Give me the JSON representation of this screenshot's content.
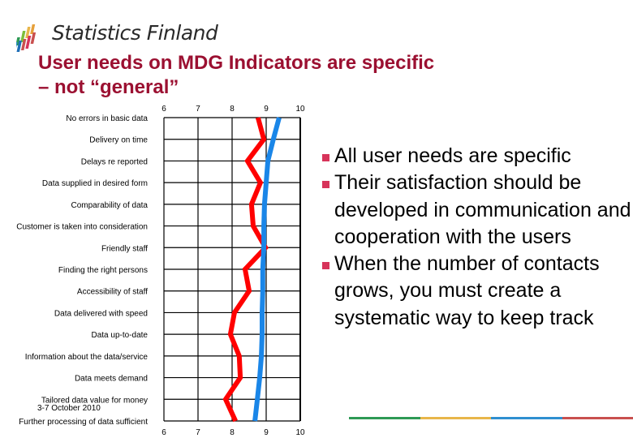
{
  "header": {
    "brand": "Statistics Finland",
    "title_line1": "User needs on MDG Indicators are specific",
    "title_line2": "– not “general”"
  },
  "footer": {
    "date": "3-7 October 2010"
  },
  "bullets": [
    "All user needs are specific",
    "Their satisfaction should be developed in communication and cooperation with the users",
    "When the number of contacts grows, you must create a systematic way to keep track"
  ],
  "colors": {
    "title": "#9b1031",
    "bullet": "#d7345a",
    "series_red": "#ff0000",
    "series_blue": "#1a86e8",
    "stripe": [
      "#2e9a55",
      "#e8b64a",
      "#2f8fd0",
      "#c9504f"
    ],
    "logo": [
      "#2e9a55",
      "#7cbf3a",
      "#e8b64a",
      "#e6a03a",
      "#2f8fd0",
      "#1f6fb8",
      "#c9504f",
      "#d7345a"
    ]
  },
  "chart_data": {
    "type": "line",
    "orientation": "horizontal-profile",
    "title": "",
    "xlabel": "",
    "ylabel": "",
    "xlim": [
      6,
      10
    ],
    "x_ticks": [
      "6",
      "7",
      "8",
      "9",
      "10"
    ],
    "grid": true,
    "categories": [
      "No errors in basic data",
      "Delivery on time",
      "Delays re reported",
      "Data supplied in desired form",
      "Comparability of data",
      "Customer is taken into consideration",
      "Friendly staff",
      "Finding the right persons",
      "Accessibility of staff",
      "Data delivered with speed",
      "Data up-to-date",
      "Information about the data/service",
      "Data meets demand",
      "Tailored data value for money",
      "Further processing of data sufficient"
    ],
    "series": [
      {
        "name": "red",
        "color": "#ff0000",
        "values": [
          8.76,
          8.93,
          8.45,
          8.83,
          8.57,
          8.62,
          8.98,
          8.38,
          8.5,
          8.07,
          7.95,
          8.21,
          8.24,
          7.81,
          8.1
        ]
      },
      {
        "name": "blue",
        "color": "#1a86e8",
        "values": [
          9.38,
          9.21,
          9.05,
          9.0,
          8.95,
          8.93,
          8.93,
          8.9,
          8.9,
          8.88,
          8.88,
          8.86,
          8.81,
          8.74,
          8.67
        ]
      }
    ],
    "legend": "none"
  }
}
